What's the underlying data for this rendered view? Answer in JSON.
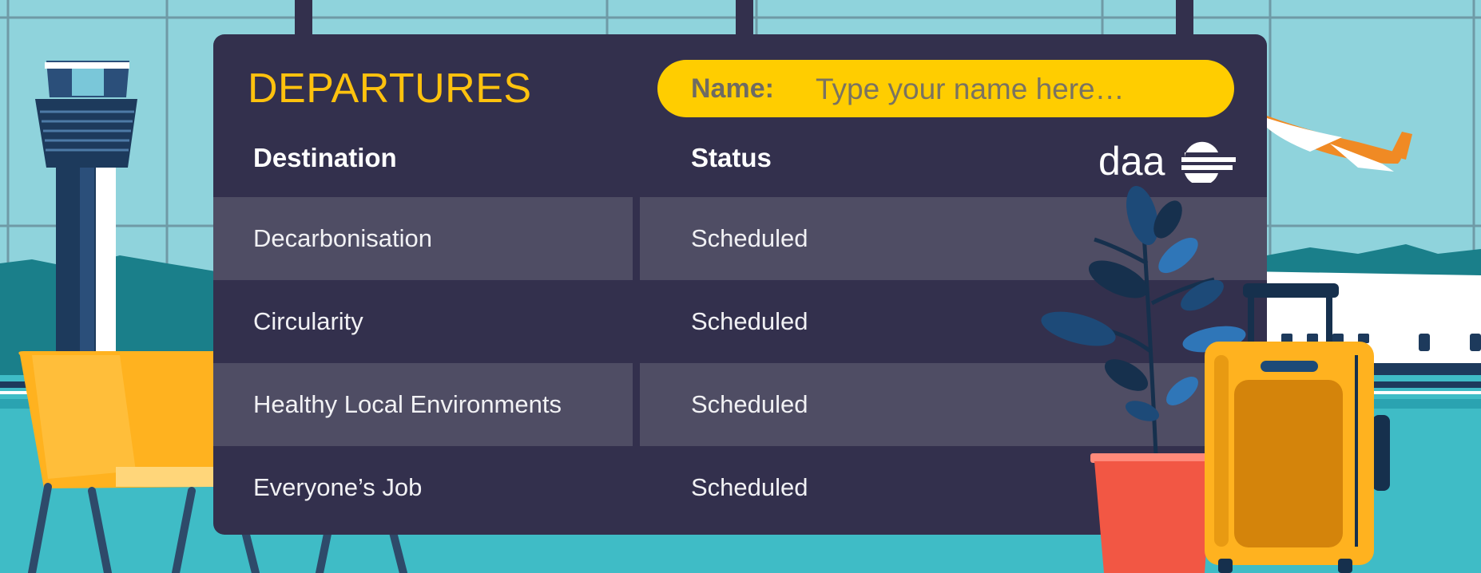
{
  "board": {
    "title": "DEPARTURES",
    "name_label": "Name:",
    "name_placeholder": "Type your name here…",
    "name_value": "",
    "col_destination": "Destination",
    "col_status": "Status",
    "logo_text": "daa"
  },
  "rows": [
    {
      "destination": "Decarbonisation",
      "status": "Scheduled"
    },
    {
      "destination": "Circularity",
      "status": "Scheduled"
    },
    {
      "destination": "Healthy Local Environments",
      "status": "Scheduled"
    },
    {
      "destination": "Everyone’s Job",
      "status": "Scheduled"
    }
  ],
  "colors": {
    "board": "#33304d",
    "row_alt": "#4f4d64",
    "accent_yellow": "#ffcd00",
    "title_yellow": "#ffc20e",
    "sky": "#8fd3dc",
    "floor": "#3fbcc6"
  },
  "icons": [
    "control-tower-icon",
    "airplane-icon",
    "plant-icon",
    "suitcase-icon",
    "chair-icon",
    "daa-logo-icon"
  ]
}
